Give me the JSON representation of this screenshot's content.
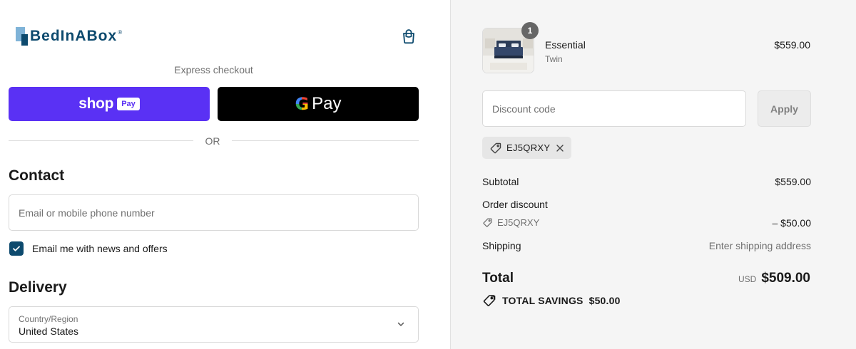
{
  "brand": {
    "name": "BedInABox",
    "reg": "®",
    "primary_color": "#0d4a6e"
  },
  "express_checkout": {
    "heading": "Express checkout",
    "shop_pay": {
      "label": "shop",
      "badge": "Pay",
      "color": "#5a31f4"
    },
    "google_pay": {
      "g": "G",
      "label": "Pay"
    },
    "divider": "OR"
  },
  "contact": {
    "heading": "Contact",
    "email_placeholder": "Email or mobile phone number",
    "email_value": "",
    "newsletter_label": "Email me with news and offers",
    "newsletter_checked": true
  },
  "delivery": {
    "heading": "Delivery",
    "country_label": "Country/Region",
    "country_value": "United States"
  },
  "order": {
    "item": {
      "name": "Essential",
      "variant": "Twin",
      "price": "$559.00",
      "quantity": "1"
    },
    "discount_placeholder": "Discount code",
    "apply_label": "Apply",
    "applied_code": "EJ5QRXY",
    "subtotal_label": "Subtotal",
    "subtotal_value": "$559.00",
    "order_discount_label": "Order discount",
    "order_discount_code": "EJ5QRXY",
    "order_discount_value": "– $50.00",
    "shipping_label": "Shipping",
    "shipping_value": "Enter shipping address",
    "total_label": "Total",
    "total_currency": "USD",
    "total_value": "$509.00",
    "savings_label": "TOTAL SAVINGS",
    "savings_value": "$50.00"
  }
}
